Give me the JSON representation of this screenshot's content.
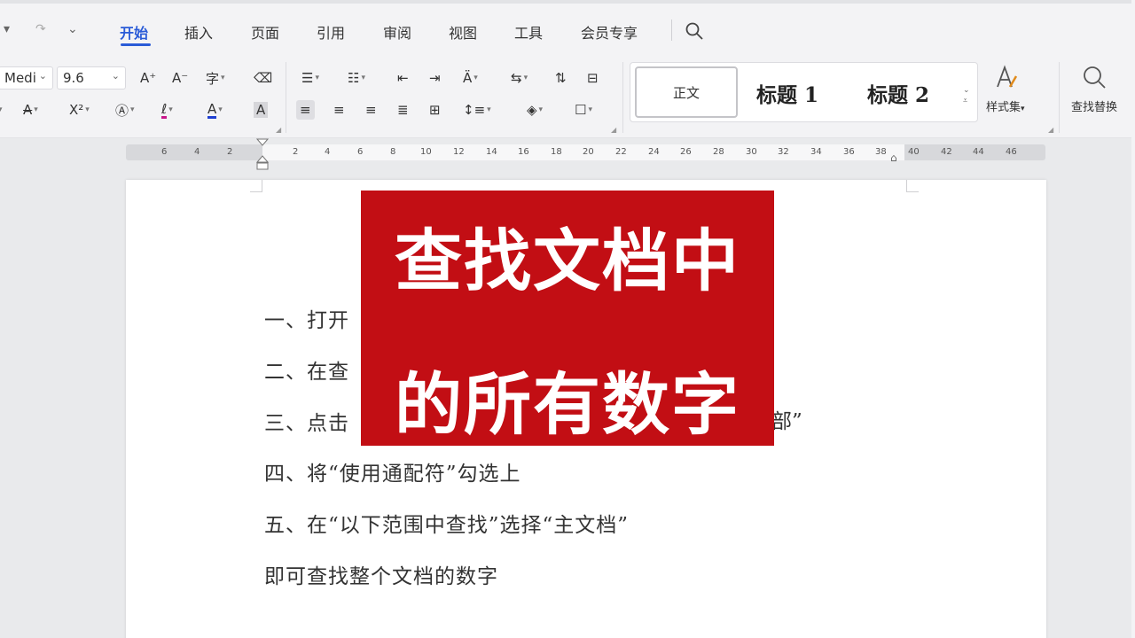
{
  "menu": {
    "tabs": [
      "开始",
      "插入",
      "页面",
      "引用",
      "审阅",
      "视图",
      "工具",
      "会员专享"
    ],
    "active_tab": "开始"
  },
  "ribbon": {
    "font_name": "Medi",
    "font_size": "9.6",
    "styles": {
      "normal": "正文",
      "heading1": "标题 1",
      "heading2": "标题 2",
      "style_set": "样式集",
      "find_replace": "查找替换"
    }
  },
  "ruler": {
    "left_numbers": [
      "6",
      "4",
      "2"
    ],
    "numbers": [
      "2",
      "4",
      "6",
      "8",
      "10",
      "12",
      "14",
      "16",
      "18",
      "20",
      "22",
      "24",
      "26",
      "28",
      "30",
      "32",
      "34",
      "36",
      "38"
    ],
    "right_numbers": [
      "40",
      "42",
      "44",
      "46"
    ]
  },
  "document": {
    "line1": "一、打开",
    "line2": "二、在查",
    "line3_start": "三、点击",
    "line3_end": "部”",
    "line4": "四、将“使用通配符”勾选上",
    "line5": "五、在“以下范围中查找”选择“主文档”",
    "line6": "即可查找整个文档的数字"
  },
  "overlay": {
    "line1": "查找文档中",
    "line2": "的所有数字",
    "color": "#c20e14"
  },
  "colors": {
    "accent": "#2a5bd7",
    "highlight": "#c8178a",
    "font_color": "#1f3fd1"
  }
}
